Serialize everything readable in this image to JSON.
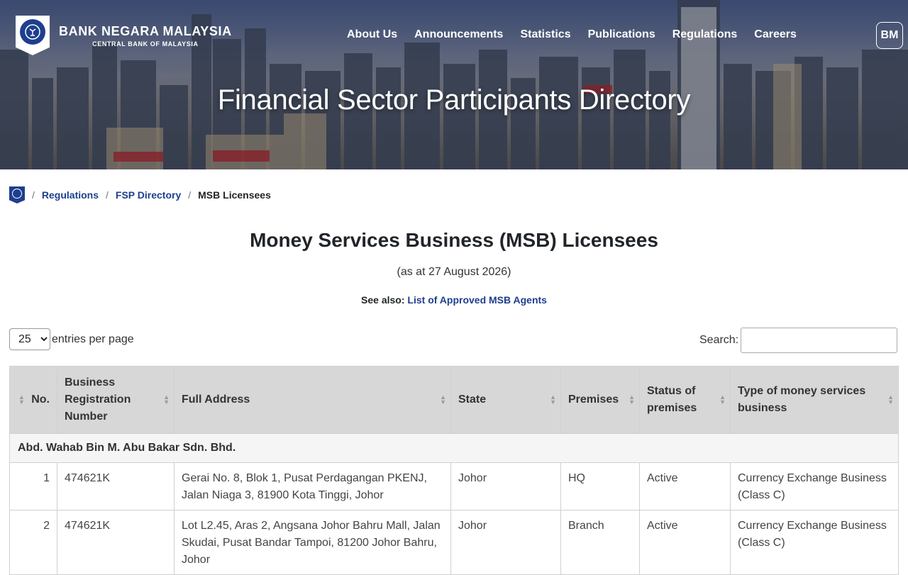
{
  "header": {
    "logo": {
      "line1": "BANK NEGARA MALAYSIA",
      "line2": "CENTRAL BANK OF MALAYSIA"
    },
    "nav": [
      "About Us",
      "Announcements",
      "Statistics",
      "Publications",
      "Regulations",
      "Careers"
    ],
    "language_label": "BM",
    "hero_title": "Financial Sector Participants Directory"
  },
  "breadcrumb": {
    "items": [
      "Regulations",
      "FSP Directory"
    ],
    "current": "MSB Licensees",
    "separator": "/"
  },
  "main": {
    "title": "Money Services Business (MSB) Licensees",
    "as_at": "(as at 27 August 2026)",
    "see_also_label": "See also:",
    "see_also_link": "List of Approved MSB Agents"
  },
  "controls": {
    "entries_value": "25",
    "entries_label": "entries per page",
    "search_label": "Search:",
    "search_value": ""
  },
  "table": {
    "headers": [
      "No.",
      "Business Registration Number",
      "Full Address",
      "State",
      "Premises",
      "Status of premises",
      "Type of money services business"
    ],
    "group": "Abd. Wahab Bin M. Abu Bakar Sdn. Bhd.",
    "rows": [
      {
        "no": "1",
        "brn": "474621K",
        "address": "Gerai No. 8, Blok 1, Pusat Perdagangan PKENJ, Jalan Niaga 3, 81900 Kota Tinggi, Johor",
        "state": "Johor",
        "premises": "HQ",
        "status": "Active",
        "type": "Currency Exchange Business (Class C)"
      },
      {
        "no": "2",
        "brn": "474621K",
        "address": "Lot L2.45, Aras 2, Angsana Johor Bahru Mall, Jalan Skudai, Pusat Bandar Tampoi, 81200 Johor Bahru, Johor",
        "state": "Johor",
        "premises": "Branch",
        "status": "Active",
        "type": "Currency Exchange Business (Class C)"
      }
    ]
  },
  "icons": {
    "search": "search-icon",
    "home": "home-logo-icon",
    "sort": "sort-icon"
  },
  "colors": {
    "link": "#1e3f8f",
    "header_bg": "#d7d7d7",
    "group_bg": "#f5f5f5"
  }
}
